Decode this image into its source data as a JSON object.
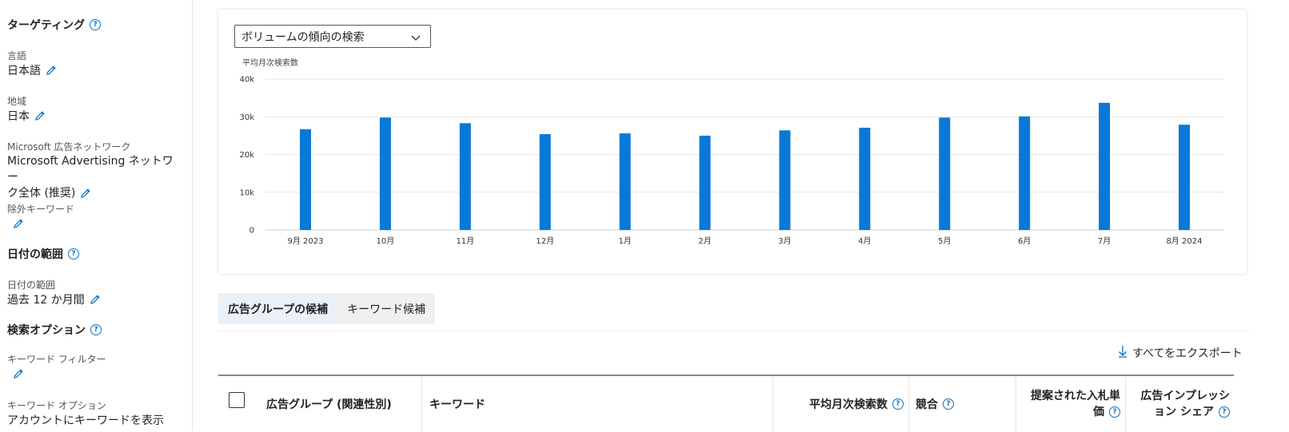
{
  "sidebar": {
    "targeting": {
      "heading": "ターゲティング"
    },
    "language": {
      "label": "言語",
      "value": "日本語"
    },
    "region": {
      "label": "地域",
      "value": "日本"
    },
    "network": {
      "label": "Microsoft 広告ネットワーク",
      "value_line1": "Microsoft Advertising ネットワー",
      "value_line2": "ク全体 (推奨)"
    },
    "negative_keywords": {
      "label": "除外キーワード"
    },
    "date_range_section": {
      "heading": "日付の範囲"
    },
    "date_range": {
      "label": "日付の範囲",
      "value": "過去 12 か月間"
    },
    "search_options": {
      "heading": "検索オプション"
    },
    "keyword_filter": {
      "label": "キーワード フィルター"
    },
    "keyword_options": {
      "label": "キーワード オプション",
      "value_partial": "アカウントにキーワードを表示"
    }
  },
  "chart_panel": {
    "dropdown_value": "ボリュームの傾向の検索"
  },
  "chart_data": {
    "type": "bar",
    "ylabel": "平均月次検索数",
    "categories": [
      "9月 2023",
      "10月",
      "11月",
      "12月",
      "1月",
      "2月",
      "3月",
      "4月",
      "5月",
      "6月",
      "7月",
      "8月 2024"
    ],
    "values": [
      26700,
      29800,
      28300,
      25400,
      25600,
      25000,
      26400,
      27100,
      29800,
      30100,
      33700,
      27900
    ],
    "yticks": [
      "0",
      "10k",
      "20k",
      "30k",
      "40k"
    ],
    "ylim": [
      0,
      40000
    ],
    "bar_color": "#0a78d7",
    "grid": true
  },
  "tabs": [
    {
      "label": "広告グループの候補",
      "active": true
    },
    {
      "label": "キーワード候補",
      "active": false
    }
  ],
  "export_label": "すべてをエクスポート",
  "table": {
    "col_adgroup": "広告グループ (関連性別)",
    "col_keyword": "キーワード",
    "col_avg_searches": "平均月次検索数",
    "col_competition": "競合",
    "col_bid_line1": "提案された入札単",
    "col_bid_line2": "価",
    "col_share_line1": "広告インプレッシ",
    "col_share_line2": "ョン シェア"
  },
  "colors": {
    "accent": "#0a6fc2",
    "bar": "#0a78d7"
  }
}
